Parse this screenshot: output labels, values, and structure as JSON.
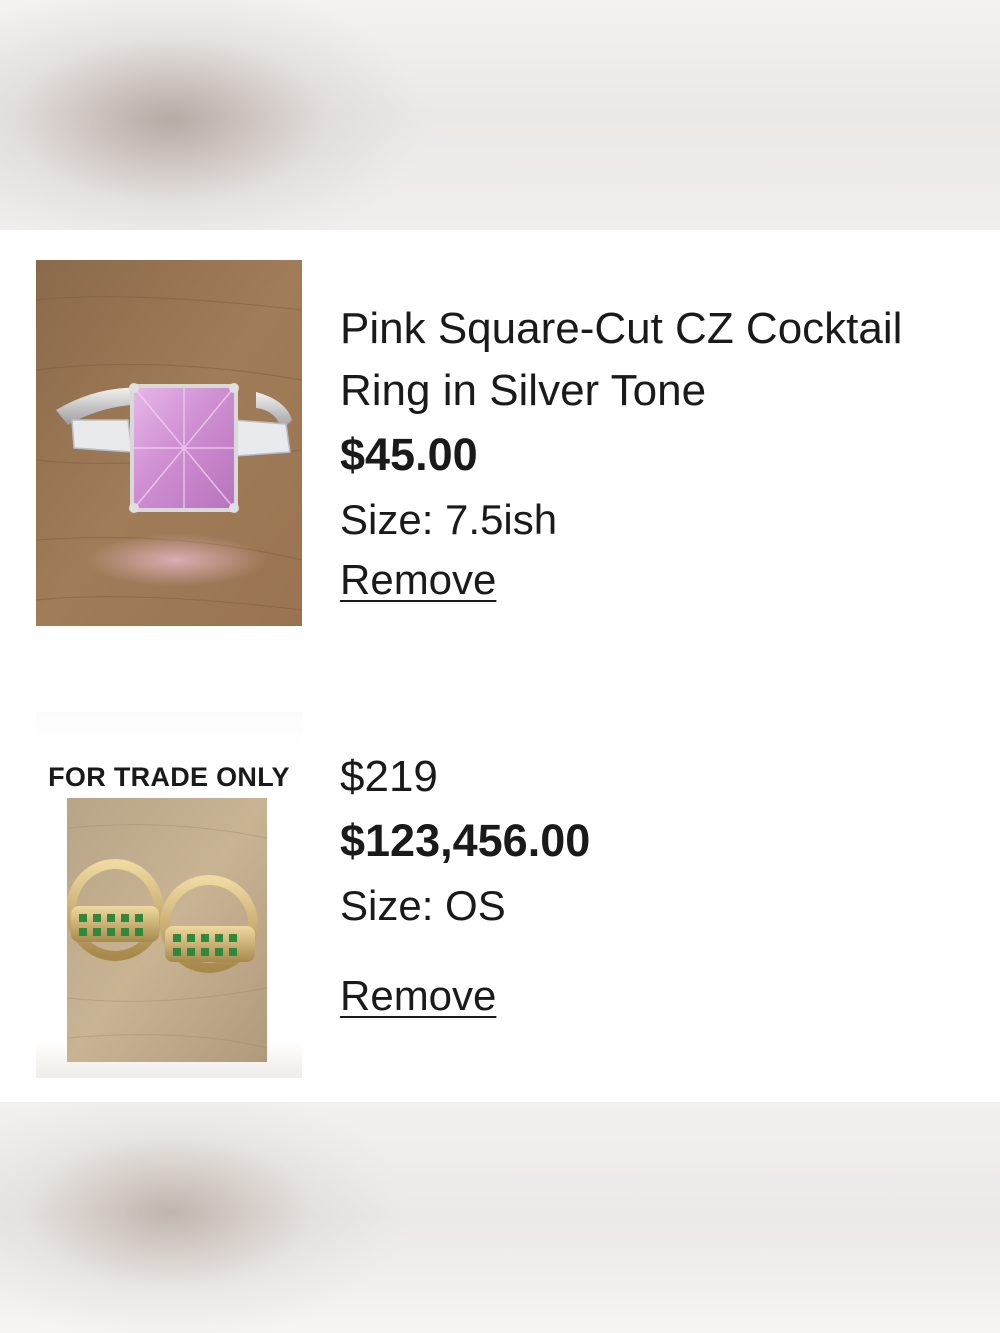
{
  "cart": {
    "items": [
      {
        "title": "Pink Square-Cut CZ Cocktail Ring in Silver Tone",
        "price": "$45.00",
        "size": "Size: 7.5ish",
        "remove_label": "Remove"
      },
      {
        "badge": "FOR TRADE ONLY",
        "original_price": "$219",
        "price": "$123,456.00",
        "size": "Size: OS",
        "remove_label": "Remove"
      }
    ]
  },
  "colors": {
    "text": "#1a1a1a",
    "background": "#ffffff"
  }
}
